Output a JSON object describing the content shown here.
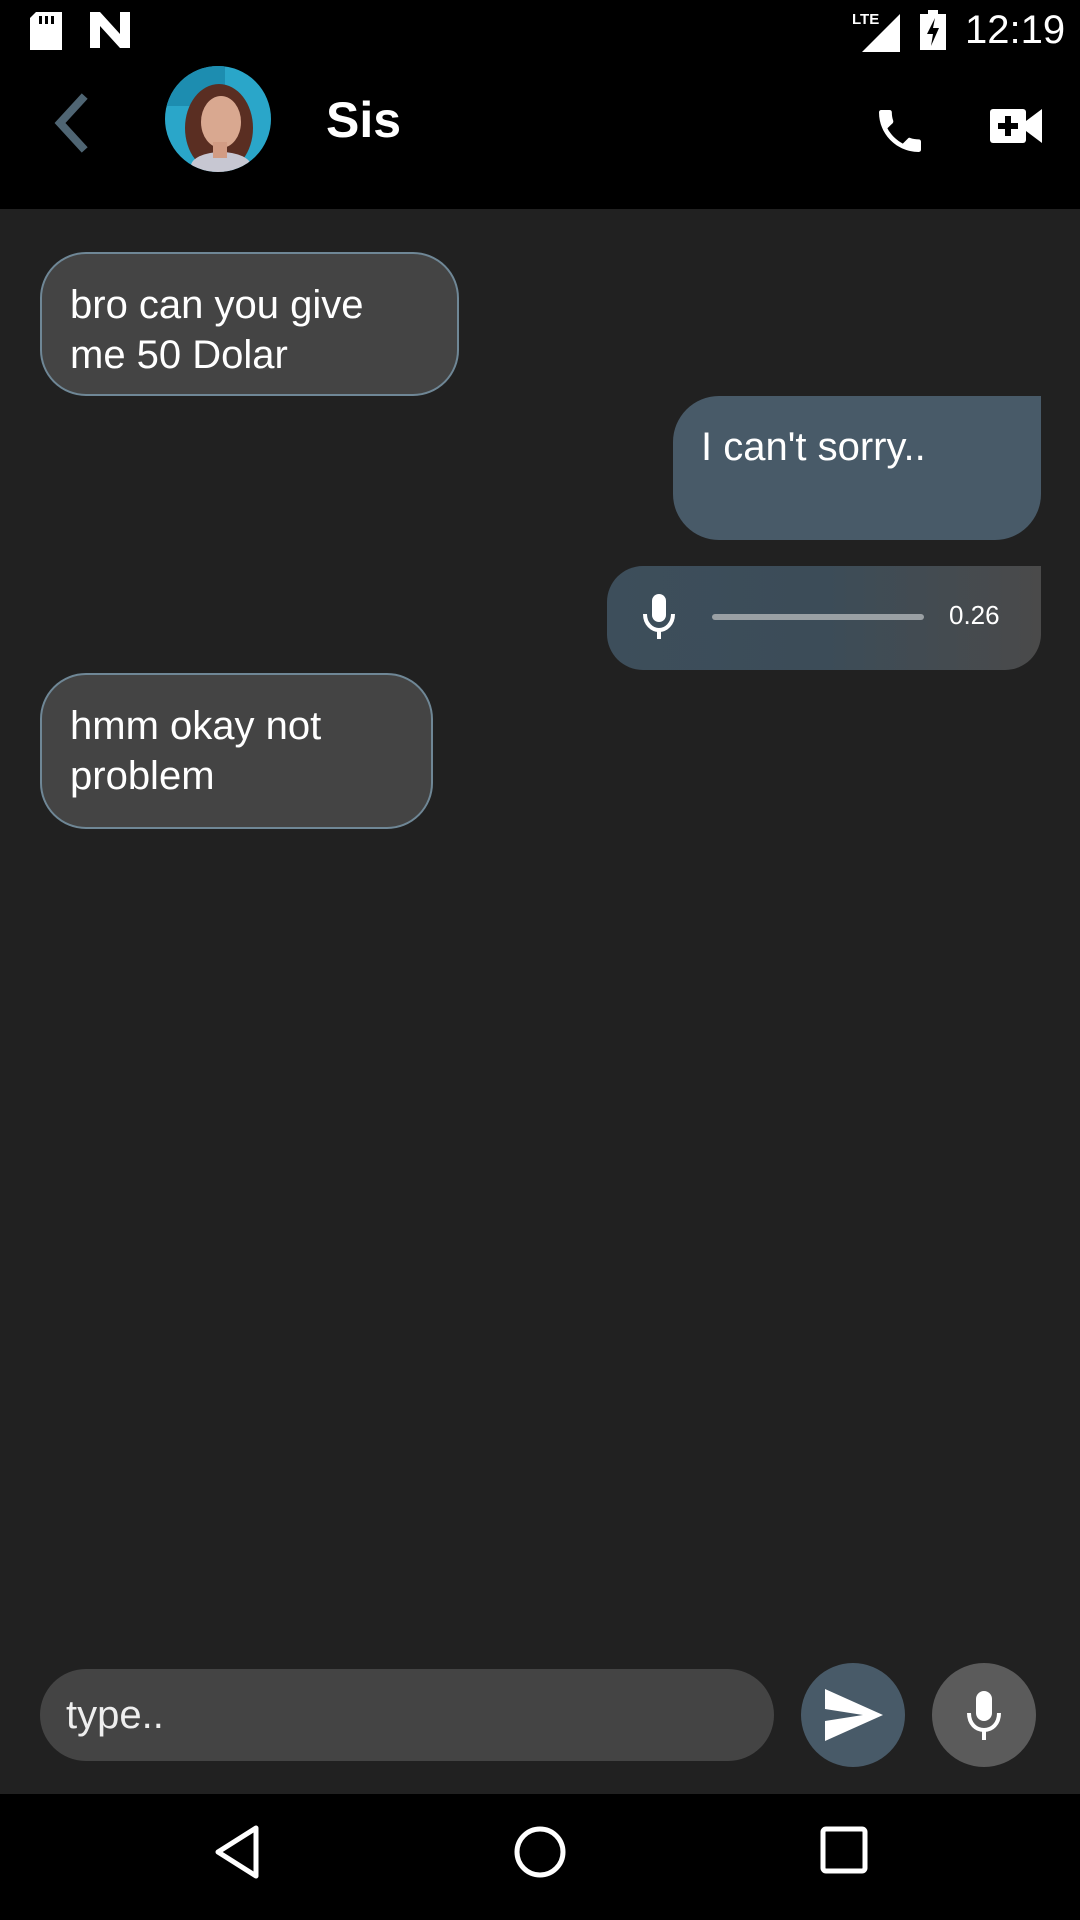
{
  "status": {
    "time": "12:19",
    "network": "LTE"
  },
  "header": {
    "title": "Sis"
  },
  "messages": [
    {
      "text": "bro can you give me 50 Dolar",
      "direction": "incoming"
    },
    {
      "text": "I can't sorry..",
      "direction": "outgoing"
    },
    {
      "type": "voice",
      "duration": "0.26",
      "direction": "outgoing"
    },
    {
      "text": "hmm okay not problem",
      "direction": "incoming"
    }
  ],
  "composer": {
    "placeholder": "type.."
  },
  "colors": {
    "background": "#212121",
    "bar": "#000000",
    "outgoing_bubble": "#485a68",
    "incoming_bubble": "#444444",
    "incoming_border": "#6f8796",
    "back_accent": "#4f6573"
  }
}
